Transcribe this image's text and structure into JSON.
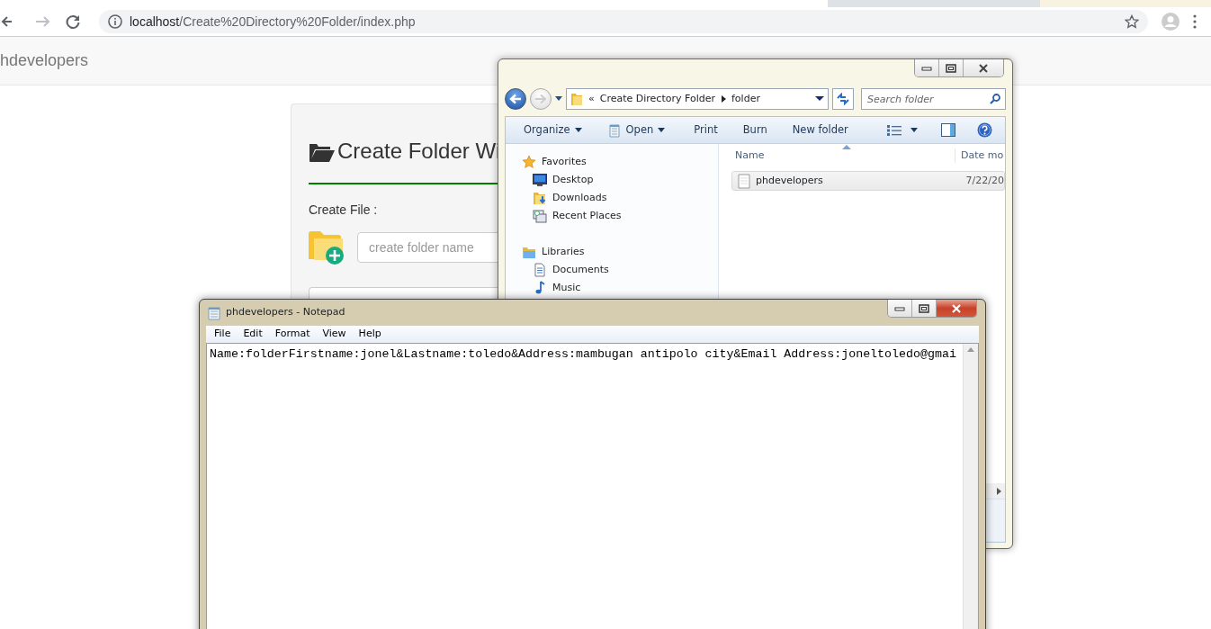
{
  "browser": {
    "url_host": "localhost",
    "url_path": "/Create%20Directory%20Folder/index.php"
  },
  "navbar": {
    "brand": "hdevelopers"
  },
  "card": {
    "title": "Create Folder Wi",
    "label": "Create File :",
    "folder_input": {
      "placeholder": "create folder name"
    }
  },
  "explorer": {
    "breadcrumb_prefix": "«",
    "breadcrumb": [
      "Create Directory Folder",
      "folder"
    ],
    "search": {
      "placeholder": "Search folder"
    },
    "toolbar": [
      {
        "label": "Organize",
        "dropdown": true
      },
      {
        "label": "Open",
        "dropdown": true
      },
      {
        "label": "Print",
        "dropdown": false
      },
      {
        "label": "Burn",
        "dropdown": false
      },
      {
        "label": "New folder",
        "dropdown": false
      }
    ],
    "nav": [
      {
        "label": "Favorites",
        "kind": "group"
      },
      {
        "label": "Desktop",
        "kind": "item"
      },
      {
        "label": "Downloads",
        "kind": "item"
      },
      {
        "label": "Recent Places",
        "kind": "item"
      },
      {
        "label": "Libraries",
        "kind": "group"
      },
      {
        "label": "Documents",
        "kind": "item"
      },
      {
        "label": "Music",
        "kind": "item"
      }
    ],
    "columns": [
      "Name",
      "Date mo"
    ],
    "files": [
      {
        "name": "phdevelopers",
        "date": "7/22/20"
      }
    ]
  },
  "notepad": {
    "title": "phdevelopers - Notepad",
    "menu": [
      "File",
      "Edit",
      "Format",
      "View",
      "Help"
    ],
    "text": "Name:folderFirstname:jonel&Lastname:toledo&Address:mambugan antipolo city&Email Address:joneltoledo@gmai"
  }
}
